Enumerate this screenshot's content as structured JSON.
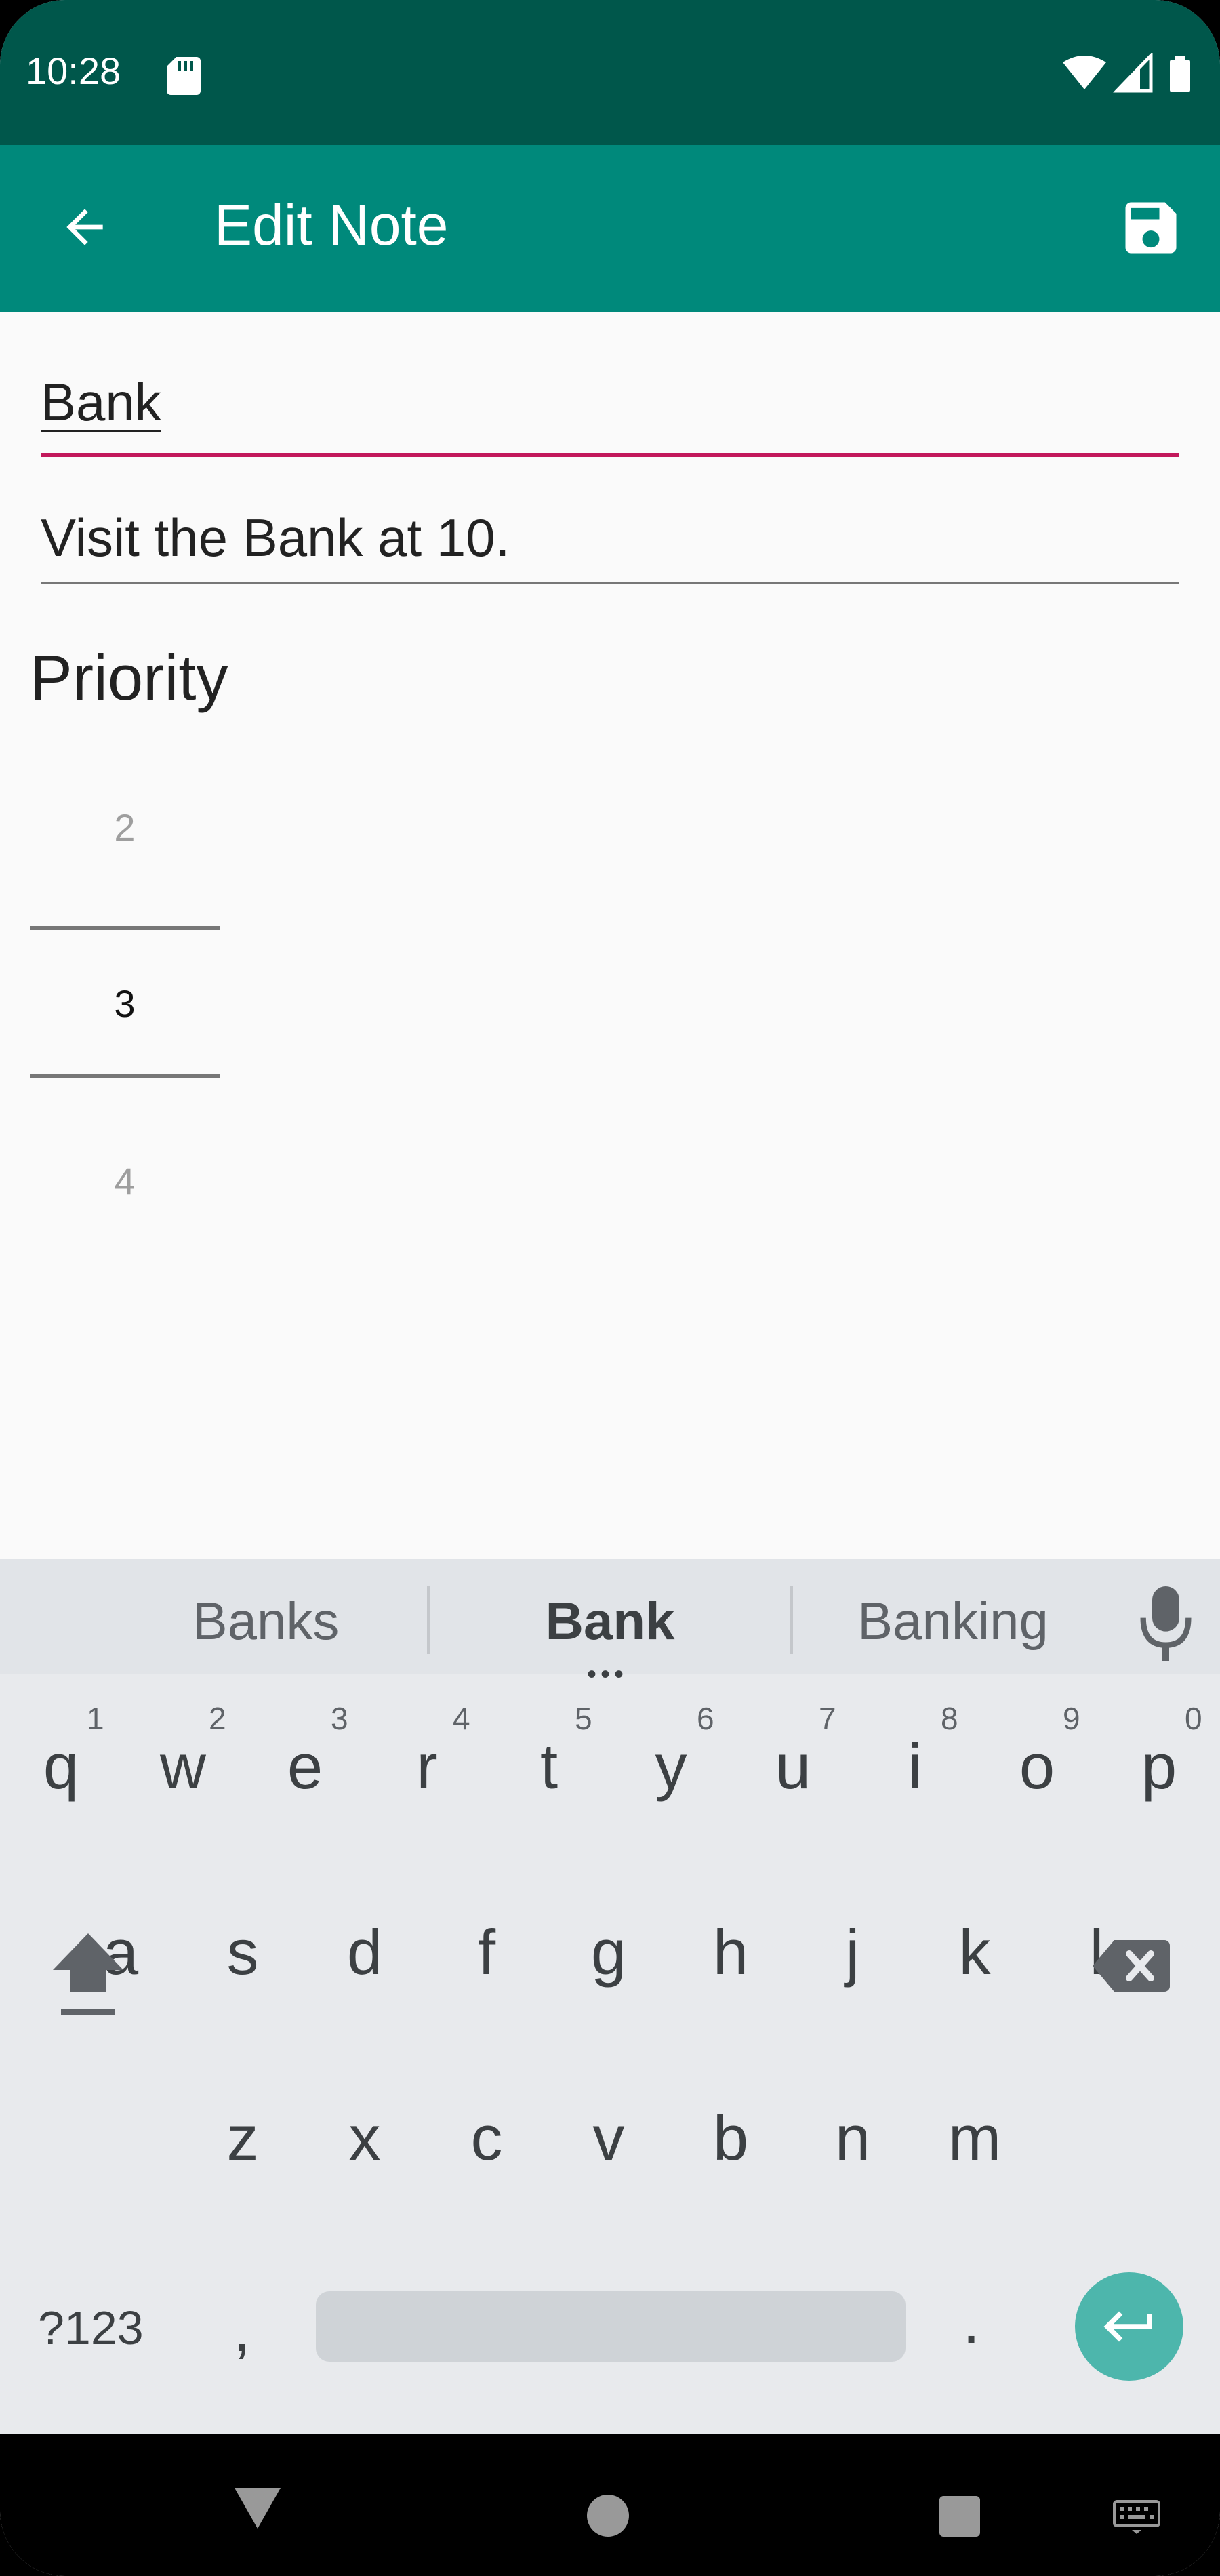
{
  "status_bar": {
    "time": "10:28"
  },
  "app_bar": {
    "title": "Edit Note",
    "back_icon": "arrow-back-icon",
    "save_icon": "save-icon"
  },
  "form": {
    "title_value": "Bank",
    "description_value": "Visit the Bank at 10.",
    "priority_label": "Priority",
    "priority_picker": {
      "prev": "2",
      "current": "3",
      "next": "4"
    }
  },
  "keyboard": {
    "suggestions": [
      "Banks",
      "Bank",
      "Banking"
    ],
    "suggestion_dots": "•••",
    "row1": [
      {
        "ch": "q",
        "num": "1"
      },
      {
        "ch": "w",
        "num": "2"
      },
      {
        "ch": "e",
        "num": "3"
      },
      {
        "ch": "r",
        "num": "4"
      },
      {
        "ch": "t",
        "num": "5"
      },
      {
        "ch": "y",
        "num": "6"
      },
      {
        "ch": "u",
        "num": "7"
      },
      {
        "ch": "i",
        "num": "8"
      },
      {
        "ch": "o",
        "num": "9"
      },
      {
        "ch": "p",
        "num": "0"
      }
    ],
    "row2": [
      "a",
      "s",
      "d",
      "f",
      "g",
      "h",
      "j",
      "k",
      "l"
    ],
    "row3": [
      "z",
      "x",
      "c",
      "v",
      "b",
      "n",
      "m"
    ],
    "symbols_label": "?123",
    "comma_label": ",",
    "period_label": "."
  },
  "colors": {
    "status_bar": "#00574b",
    "app_bar": "#00897b",
    "accent": "#c2185b",
    "enter_key": "#4db6ac"
  }
}
